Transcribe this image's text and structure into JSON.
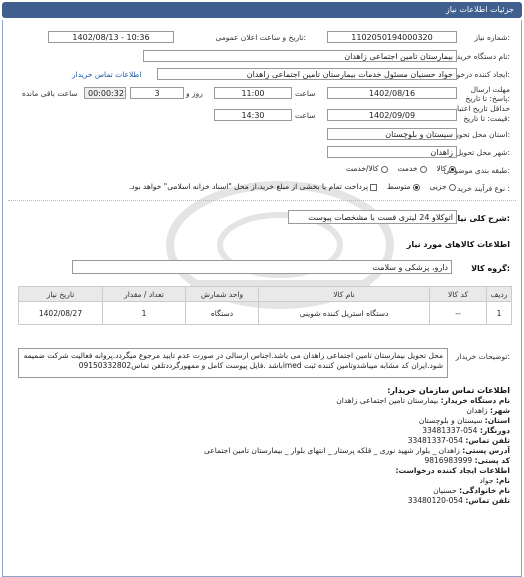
{
  "page_title": "جزئیات اطلاعات نیاز",
  "need_number": {
    "label": "شماره نیاز:",
    "value": "1102050194000320"
  },
  "announce": {
    "label": "تاریخ و ساعت اعلان عمومی:",
    "value": "1402/08/13 - 10:36"
  },
  "buyer": {
    "label": "نام دستگاه خریدار:",
    "value": "بیمارستان تامین اجتماعی زاهدان"
  },
  "requester": {
    "label": "ایجاد کننده درخواست:",
    "value": "جواد حسنیان مسئول خدمات بیمارستان تامین اجتماعی زاهدان",
    "link": "اطلاعات تماس خریدار"
  },
  "deadline": {
    "label": "مهلت ارسال پاسخ: تا تاریخ:",
    "date": "1402/08/16",
    "time_label": "ساعت",
    "time": "11:00",
    "days": "3",
    "days_label": "روز و",
    "remaining": "00:00:32",
    "remaining_label": "ساعت باقی مانده"
  },
  "validity": {
    "label1": "حداقل تاریخ اعتبار",
    "label2": "قیمت: تا تاریخ:",
    "date": "1402/09/09",
    "time_label": "ساعت",
    "time": "14:30"
  },
  "province": {
    "label": "استان محل تحویل:",
    "value": "سیستان و بلوچستان"
  },
  "city": {
    "label": "شهر محل تحویل:",
    "value": "زاهدان"
  },
  "category": {
    "label": "طبقه بندی موضوعی:",
    "options": [
      "کالا",
      "خدمت",
      "کالا/خدمت"
    ],
    "selected": "کالا"
  },
  "process": {
    "label": "نوع فرآیند خرید :",
    "options": [
      "جزیی",
      "متوسط"
    ],
    "selected": "متوسط",
    "note": "پرداخت تمام یا بخشی از مبلغ خرید،از محل \"اسناد خزانه اسلامی\" خواهد بود."
  },
  "summary": {
    "label": "شرح کلی نیاز:",
    "value": "اتوکلاو 24 لیتری فست با مشخصات پیوست"
  },
  "goods_title": "اطلاعات کالاهای مورد نیاز",
  "goods_group": {
    "label": "گروه کالا:",
    "value": "دارو، پزشکی و سلامت"
  },
  "table": {
    "headers": [
      "ردیف",
      "کد کالا",
      "نام کالا",
      "واحد شمارش",
      "تعداد / مقدار",
      "تاریخ نیاز"
    ],
    "rows": [
      [
        "1",
        "--",
        "دستگاه استریل کننده شوینی",
        "دستگاه",
        "1",
        "1402/08/27"
      ]
    ]
  },
  "buyer_notes": {
    "label": "توضیحات خریدار:",
    "value": "محل تحویل بیمارستان تامین اجتماعی زاهدان می باشد.اجناس ارسالی در صورت عدم تایید مرجوع میگردد.پروانه فعالیت شرکت ضمیمه شود.ایران کد مشابه میباشدوتامین کننده ثبت imedباشد .فایل پیوست کامل و ممهورگرددتلفن تماس09150332802"
  },
  "contact": {
    "title": "اطلاعات تماس سازمان خریدار:",
    "lines": [
      {
        "k": "نام دستگاه خریدار:",
        "v": " بیمارستان تامین اجتماعی زاهدان"
      },
      {
        "k": "شهر:",
        "v": " زاهدان"
      },
      {
        "k": "استان:",
        "v": " سیستان و بلوچستان"
      },
      {
        "k": "دورنگار:",
        "v": " 054-33481337"
      },
      {
        "k": "تلفن تماس:",
        "v": " 054-33481337"
      },
      {
        "k": "آدرس پستی:",
        "v": " زاهدان _ بلوار شهید نوری _ قلکه پرستار _ انتهای بلوار _ بیمارستان تامین اجتماعی"
      },
      {
        "k": "کد پستی:",
        "v": " 9816983999"
      },
      {
        "k": "اطلاعات ایجاد کننده درخواست:",
        "v": ""
      },
      {
        "k": "نام:",
        "v": " جواد"
      },
      {
        "k": "نام خانوادگی:",
        "v": " حسنیان"
      },
      {
        "k": "تلفن تماس:",
        "v": " 054-33480120"
      }
    ]
  },
  "colors": {
    "header": "#3f5f8e",
    "link": "#1a5aa6"
  }
}
